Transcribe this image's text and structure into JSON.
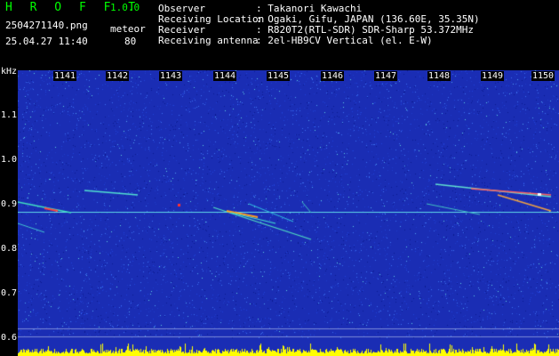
{
  "header": {
    "logo": "H R O F F T",
    "version": "1.0.0",
    "filename": "2504271140.png",
    "meteor_label": "meteor",
    "datetime": "25.04.27 11:40",
    "meteor_count": "80"
  },
  "info": [
    {
      "label": "Observer",
      "value": ": Takanori Kawachi"
    },
    {
      "label": "Receiving Location",
      "value": ": Ogaki, Gifu, JAPAN (136.60E, 35.35N)"
    },
    {
      "label": "Receiver",
      "value": ": R820T2(RTL-SDR) SDR-Sharp 53.372MHz"
    },
    {
      "label": "Receiving antenna",
      "value": ": 2el-HB9CV Vertical (el. E-W)"
    }
  ],
  "axis": {
    "unit": "kHz",
    "y_ticks": [
      "1.1",
      "1.0",
      "0.9",
      "0.8",
      "0.7",
      "0.6"
    ],
    "time_ticks": [
      "1141",
      "1142",
      "1143",
      "1144",
      "1145",
      "1146",
      "1147",
      "1148",
      "1149",
      "1150"
    ]
  },
  "colors": {
    "background": "#1a2db4",
    "text_green": "#00ff00",
    "noise_bar": "#ffff00"
  }
}
